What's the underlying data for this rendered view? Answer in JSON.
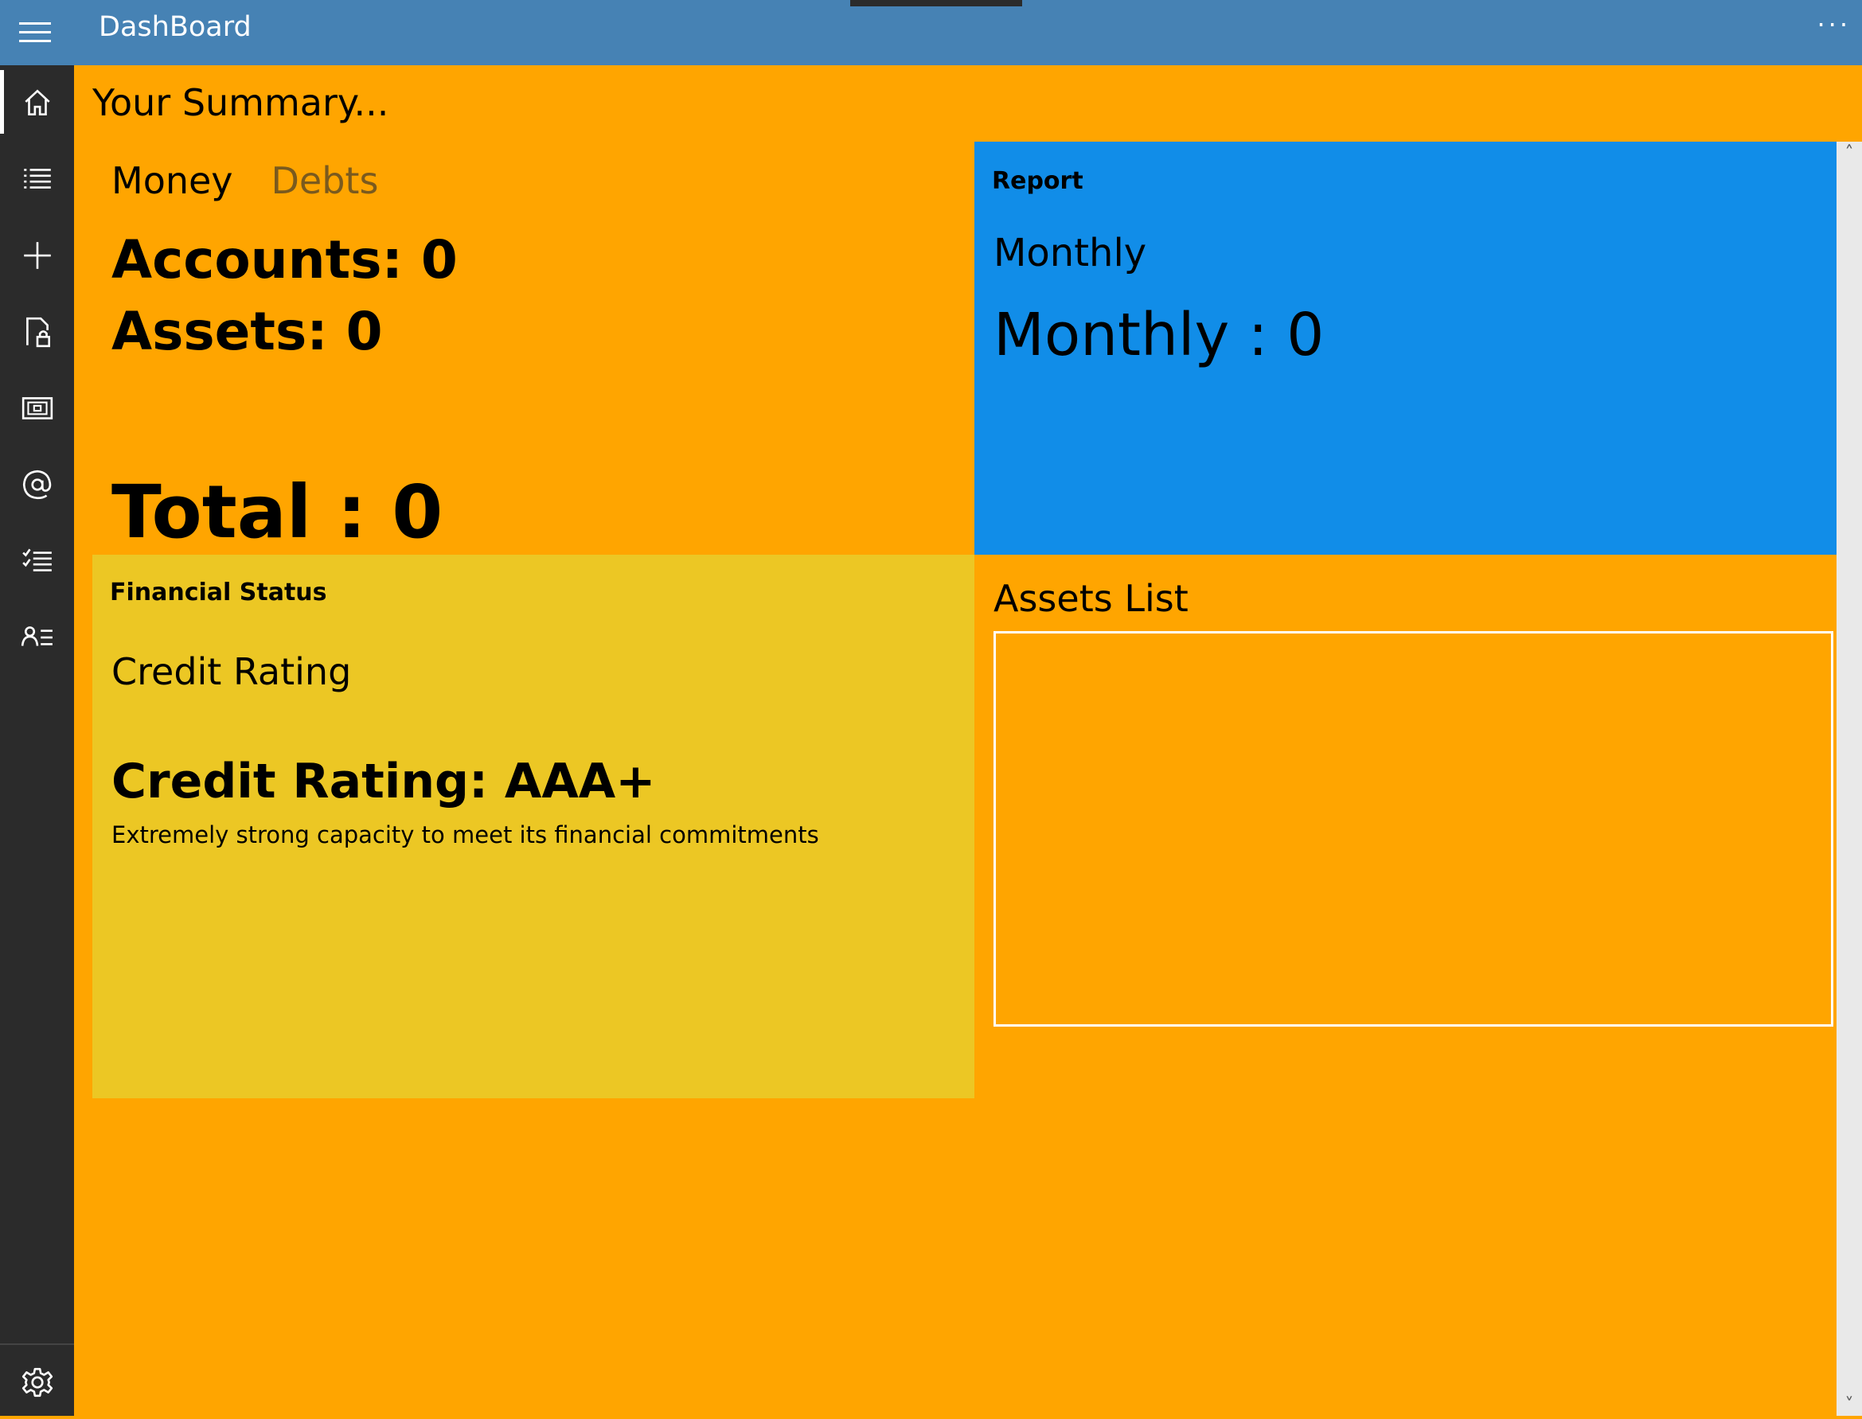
{
  "app": {
    "title": "DashBoard",
    "more_label": "···"
  },
  "nav": {
    "items": [
      {
        "name": "home",
        "icon": "home-icon",
        "selected": true
      },
      {
        "name": "list",
        "icon": "list-icon"
      },
      {
        "name": "add",
        "icon": "plus-icon"
      },
      {
        "name": "locked-document",
        "icon": "lock-document-icon"
      },
      {
        "name": "money",
        "icon": "money-icon"
      },
      {
        "name": "contact",
        "icon": "at-icon"
      },
      {
        "name": "checklist",
        "icon": "checklist-icon"
      },
      {
        "name": "profile",
        "icon": "person-list-icon"
      }
    ],
    "settings_icon": "gear-icon"
  },
  "summary": {
    "title": "Your Summary..."
  },
  "money_panel": {
    "tabs": [
      "Money",
      "Debts"
    ],
    "accounts": "Accounts: 0",
    "assets": "Assets: 0",
    "total": "Total : 0"
  },
  "report_panel": {
    "header": "Report",
    "subheader": "Monthly",
    "value": "Monthly : 0"
  },
  "status_panel": {
    "header": "Financial Status",
    "subheader": "Credit Rating",
    "rating": "Credit Rating: AAA+",
    "description": "Extremely strong capacity to meet its financial commitments"
  },
  "assets_panel": {
    "header": "Assets List"
  },
  "colors": {
    "titlebar": "#4682b4",
    "navrail": "#2b2b2b",
    "background": "#ffa500",
    "report": "#118de8",
    "status": "#ecc724"
  }
}
